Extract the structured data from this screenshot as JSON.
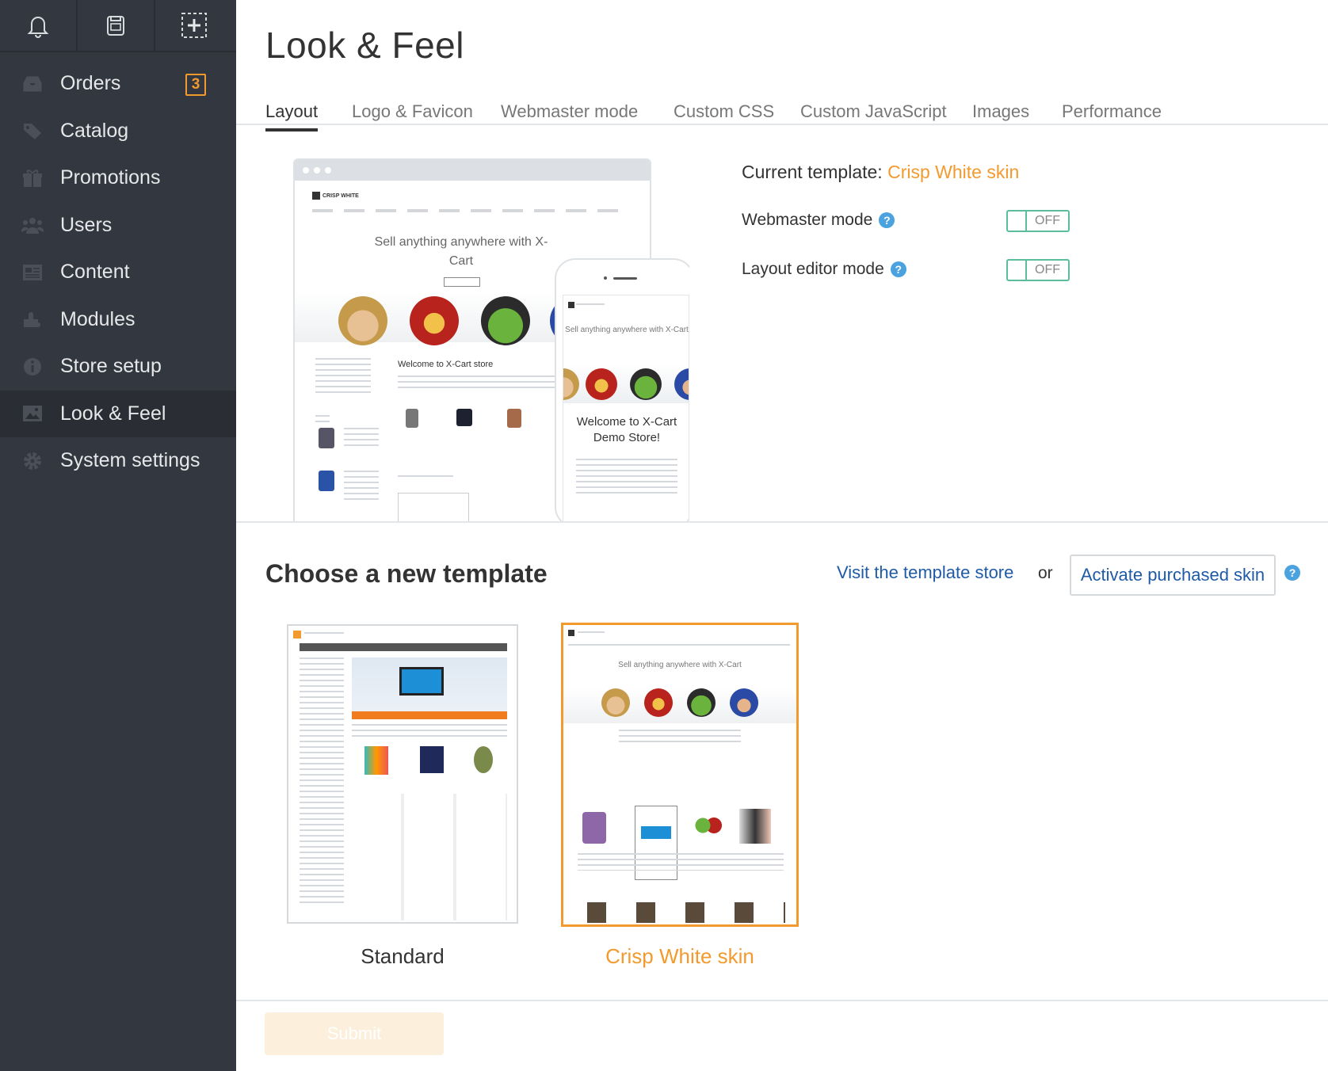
{
  "topbar": {
    "icons": [
      "bell-icon",
      "store-icon",
      "add-icon"
    ]
  },
  "sidebar": {
    "items": [
      {
        "label": "Orders",
        "icon": "orders-icon",
        "badge": "3"
      },
      {
        "label": "Catalog",
        "icon": "catalog-icon"
      },
      {
        "label": "Promotions",
        "icon": "promotions-icon"
      },
      {
        "label": "Users",
        "icon": "users-icon"
      },
      {
        "label": "Content",
        "icon": "content-icon"
      },
      {
        "label": "Modules",
        "icon": "modules-icon"
      },
      {
        "label": "Store setup",
        "icon": "store-setup-icon"
      },
      {
        "label": "Look & Feel",
        "icon": "look-feel-icon",
        "active": true
      },
      {
        "label": "System settings",
        "icon": "settings-icon"
      }
    ]
  },
  "page": {
    "title": "Look & Feel"
  },
  "tabs": [
    {
      "label": "Layout",
      "active": true
    },
    {
      "label": "Logo & Favicon"
    },
    {
      "label": "Webmaster mode"
    },
    {
      "label": "Custom CSS"
    },
    {
      "label": "Custom JavaScript"
    },
    {
      "label": "Images"
    },
    {
      "label": "Performance"
    }
  ],
  "current": {
    "label": "Current template:",
    "value": "Crisp White skin",
    "webmaster_label": "Webmaster mode",
    "webmaster_state": "OFF",
    "layout_editor_label": "Layout editor mode",
    "layout_editor_state": "OFF"
  },
  "preview": {
    "desktop_logo": "CRISP WHITE",
    "desktop_hero": "Sell anything anywhere with X-Cart",
    "desktop_welcome": "Welcome to X-Cart store",
    "mobile_hero": "Sell anything anywhere with X-Cart",
    "mobile_welcome": "Welcome to X-Cart Demo Store!"
  },
  "choose": {
    "title": "Choose a new template",
    "visit_link": "Visit the template store",
    "or": "or",
    "activate_button": "Activate purchased skin"
  },
  "templates": [
    {
      "name": "Standard",
      "selected": false
    },
    {
      "name": "Crisp White skin",
      "selected": true
    }
  ],
  "submit": {
    "label": "Submit"
  },
  "colors": {
    "sidebar_bg": "#33373f",
    "accent_orange": "#f39a2e",
    "link_blue": "#1f5aa6",
    "toggle_green": "#5bbd9a",
    "help_blue": "#4aa3df"
  }
}
